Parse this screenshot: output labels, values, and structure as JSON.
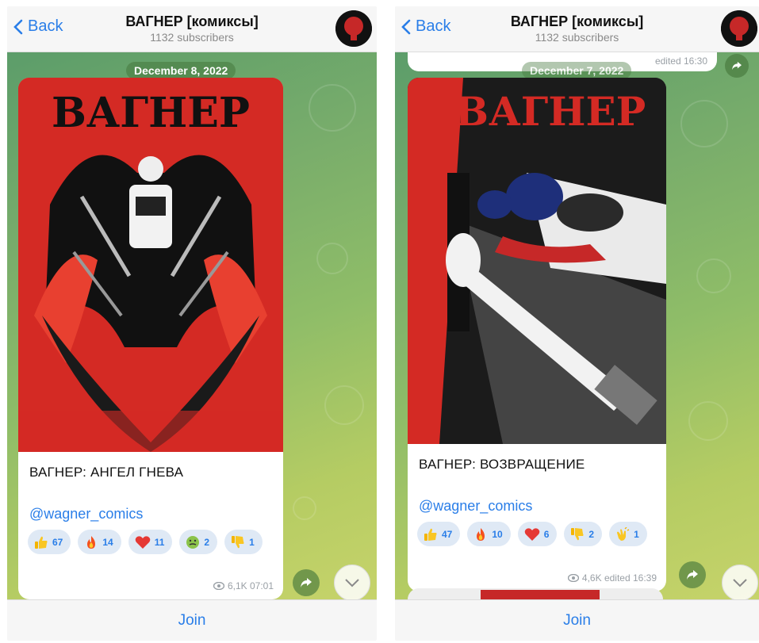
{
  "left": {
    "header": {
      "back_label": "Back",
      "title": "ВАГНЕР [комиксы]",
      "subtitle": "1132 subscribers"
    },
    "date": "December 8, 2022",
    "post": {
      "cover_title": "ВАГНЕР",
      "caption": "ВАГНЕР: АНГЕЛ ГНЕВА",
      "link": "@wagner_comics",
      "reactions": [
        {
          "emoji": "thumbs-up-icon",
          "count": "67"
        },
        {
          "emoji": "fire-icon",
          "count": "14"
        },
        {
          "emoji": "heart-icon",
          "count": "11"
        },
        {
          "emoji": "nauseated-face-icon",
          "count": "2"
        },
        {
          "emoji": "thumbs-down-icon",
          "count": "1"
        }
      ],
      "views": "6,1K",
      "time": "07:01"
    },
    "join_label": "Join"
  },
  "right": {
    "header": {
      "back_label": "Back",
      "title": "ВАГНЕР [комиксы]",
      "subtitle": "1132 subscribers"
    },
    "date": "December 7, 2022",
    "prev_meta": "edited 16:30",
    "post": {
      "cover_title": "ВАГНЕР",
      "caption": "ВАГНЕР: ВОЗВРАЩЕНИЕ",
      "link": "@wagner_comics",
      "reactions": [
        {
          "emoji": "thumbs-up-icon",
          "count": "47"
        },
        {
          "emoji": "fire-icon",
          "count": "10"
        },
        {
          "emoji": "heart-icon",
          "count": "6"
        },
        {
          "emoji": "thumbs-down-icon",
          "count": "2"
        },
        {
          "emoji": "clapping-hands-icon",
          "count": "1"
        }
      ],
      "views": "4,6K",
      "time": "edited 16:39"
    },
    "join_label": "Join"
  },
  "colors": {
    "accent": "#2a7ee8",
    "cover_red": "#d42a24",
    "chat_green": "#79ad6b"
  }
}
